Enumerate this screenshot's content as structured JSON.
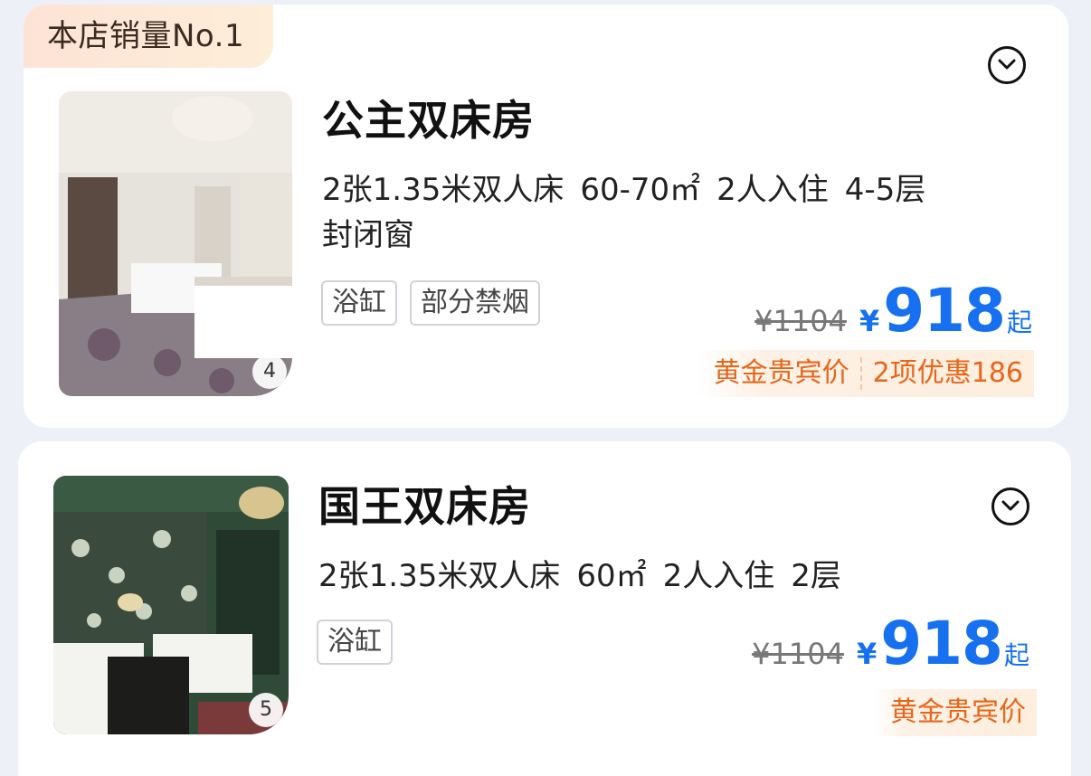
{
  "rooms": [
    {
      "ribbon": "本店销量No.1",
      "name": "公主双床房",
      "specs": [
        "2张1.35米双人床",
        "60-70㎡",
        "2人入住",
        "4-5层"
      ],
      "specs2": "封闭窗",
      "tags": [
        "浴缸",
        "部分禁烟"
      ],
      "image_count": "4",
      "original_price": "¥1104",
      "currency": "¥",
      "price": "918",
      "price_suffix": "起",
      "promo_label": "黄金贵宾价",
      "promo_detail": "2项优惠186"
    },
    {
      "name": "国王双床房",
      "specs": [
        "2张1.35米双人床",
        "60㎡",
        "2人入住",
        "2层"
      ],
      "tags": [
        "浴缸"
      ],
      "image_count": "5",
      "original_price": "¥1104",
      "currency": "¥",
      "price": "918",
      "price_suffix": "起",
      "promo_label": "黄金贵宾价"
    }
  ],
  "icons": {
    "expand": "chevron-down-circle-icon"
  },
  "colors": {
    "price": "#1670f0",
    "promo": "#e8651a",
    "ribbon_bg": "#fde3d6"
  }
}
